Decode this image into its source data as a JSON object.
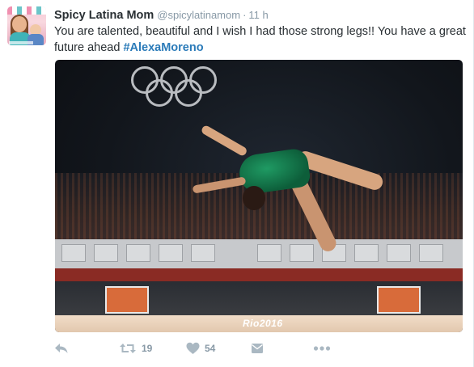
{
  "tweet": {
    "author_name": "Spicy Latina Mom",
    "author_handle": "@spicylatinamom",
    "separator": "·",
    "timestamp": "11 h",
    "text_plain": "You are talented, beautiful and I wish I had those strong legs!! You have a great future ahead ",
    "hashtag": "#AlexaMoreno",
    "media": {
      "beam_logo_text": "Rio2016"
    },
    "actions": {
      "reply_icon": "reply-icon",
      "retweet_icon": "retweet-icon",
      "retweet_count": "19",
      "like_icon": "heart-icon",
      "like_count": "54",
      "dm_icon": "message-icon",
      "more_icon": "more-icon"
    }
  },
  "colors": {
    "text": "#292f33",
    "secondary": "#8899a6",
    "link": "#2b7bb9",
    "action_icon": "#aab8c2"
  }
}
